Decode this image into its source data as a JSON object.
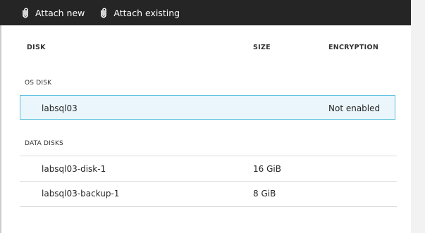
{
  "toolbar": {
    "attach_new_label": "Attach new",
    "attach_existing_label": "Attach existing",
    "icon": "paperclip-icon"
  },
  "table": {
    "columns": {
      "disk": "DISK",
      "size": "SIZE",
      "encryption": "ENCRYPTION"
    },
    "os_section": {
      "label": "OS DISK",
      "row": {
        "name": "labsql03",
        "size": "",
        "encryption": "Not enabled",
        "selected": true
      }
    },
    "data_section": {
      "label": "DATA DISKS",
      "rows": [
        {
          "name": "labsql03-disk-1",
          "size": "16 GiB",
          "encryption": ""
        },
        {
          "name": "labsql03-backup-1",
          "size": "8 GiB",
          "encryption": ""
        }
      ]
    }
  },
  "colors": {
    "toolbar_bg": "#252525",
    "selected_row_bg": "#eaf6fb",
    "selected_row_border": "#5bc0de"
  }
}
